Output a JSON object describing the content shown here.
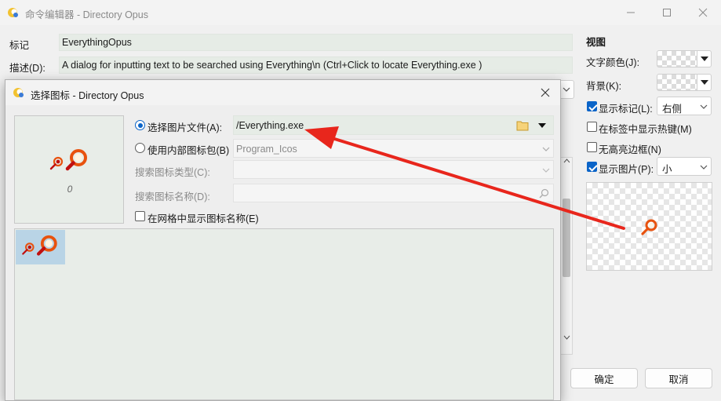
{
  "main_window": {
    "title": "命令编辑器 - Directory Opus",
    "tag_label": "标记",
    "tag_value": "EverythingOpus",
    "desc_label": "描述(D):",
    "desc_value": "A dialog for inputting text to be searched using Everything\\n (Ctrl+Click to locate Everything.exe )"
  },
  "view_panel": {
    "heading": "视图",
    "text_color_label": "文字颜色(J):",
    "background_label": "背景(K):",
    "show_label_label": "显示标记(L):",
    "show_label_value": "右侧",
    "show_hotkey_label": "在标签中显示热键(M)",
    "no_highlight_label": "无高亮边框(N)",
    "show_image_label": "显示图片(P):",
    "show_image_value": "小",
    "checked": {
      "show_label": true,
      "show_hotkey": false,
      "no_highlight": false,
      "show_image": true
    }
  },
  "buttons": {
    "ok": "确定",
    "cancel": "取消"
  },
  "dialog": {
    "title": "选择图标 - Directory Opus",
    "preview_index": "0",
    "option_file_label": "选择图片文件(A):",
    "file_value": "/Everything.exe",
    "option_internal_label": "使用内部图标包(B)",
    "internal_value": "Program_Icos",
    "search_type_label": "搜索图标类型(C):",
    "search_name_label": "搜索图标名称(D):",
    "grid_names_label": "在网格中显示图标名称(E)"
  },
  "colors": {
    "accent": "#0a64c8",
    "arrow": "#e8261c",
    "icon_orange": "#e8520e"
  },
  "icons": [
    "directory-opus-app-icon",
    "minimize-icon",
    "maximize-icon",
    "close-icon",
    "folder-icon",
    "dropdown-arrow-icon",
    "search-icon",
    "chevron-down-icon",
    "everything-magnifier-icon"
  ]
}
